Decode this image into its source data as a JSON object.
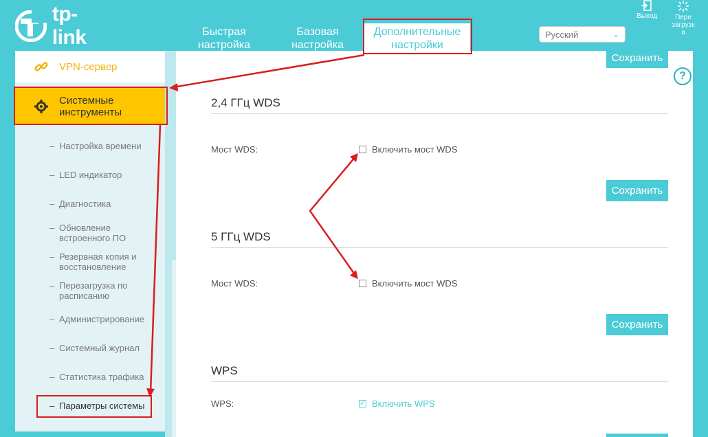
{
  "header": {
    "logo_text": "tp-link",
    "nav": [
      {
        "line1": "Быстрая",
        "line2": "настройка"
      },
      {
        "line1": "Базовая",
        "line2": "настройка"
      },
      {
        "line1": "Дополнительные",
        "line2": "настройки"
      }
    ],
    "language": "Русский",
    "logout_label": "Выход",
    "reboot_label_l1": "Пере",
    "reboot_label_l2": "загрузк",
    "reboot_label_l3": "а"
  },
  "sidebar": {
    "top_item": "VPN-сервер",
    "active_item_l1": "Системные",
    "active_item_l2": "инструменты",
    "sub_items": [
      {
        "l1": "Настройка времени",
        "l2": ""
      },
      {
        "l1": "LED индикатор",
        "l2": ""
      },
      {
        "l1": "Диагностика",
        "l2": ""
      },
      {
        "l1": "Обновление",
        "l2": "встроенного ПО"
      },
      {
        "l1": "Резервная копия и",
        "l2": "восстановление"
      },
      {
        "l1": "Перезагрузка по",
        "l2": "расписанию"
      },
      {
        "l1": "Администрирование",
        "l2": ""
      },
      {
        "l1": "Системный журнал",
        "l2": ""
      },
      {
        "l1": "Статистика трафика",
        "l2": ""
      },
      {
        "l1": "Параметры системы",
        "l2": ""
      }
    ]
  },
  "main": {
    "save_label": "Сохранить",
    "sections": [
      {
        "title": "2,4 ГГц WDS",
        "field_label": "Мост WDS:",
        "checkbox_label": "Включить мост WDS"
      },
      {
        "title": "5 ГГц WDS",
        "field_label": "Мост WDS:",
        "checkbox_label": "Включить мост WDS"
      },
      {
        "title": "WPS",
        "field_label": "WPS:",
        "checkbox_label": "Включить WPS"
      }
    ],
    "help": "?"
  },
  "colors": {
    "brand": "#4acbd6",
    "active_menu": "#ffc600",
    "annotation": "#d81e1e"
  }
}
